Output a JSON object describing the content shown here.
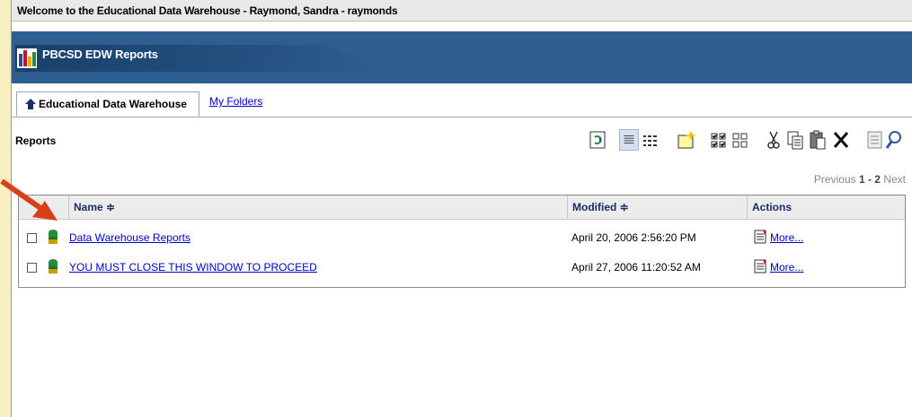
{
  "welcome": "Welcome to the Educational Data Warehouse - Raymond, Sandra - raymonds",
  "banner": {
    "title": "PBCSD EDW Reports"
  },
  "tabs": {
    "active": "Educational Data Warehouse",
    "my_folders": "My Folders"
  },
  "section_title": "Reports",
  "pager": {
    "previous": "Previous",
    "range": "1 - 2",
    "next": "Next"
  },
  "table": {
    "headers": {
      "name": "Name ≑",
      "modified": "Modified ≑",
      "actions": "Actions"
    },
    "rows": [
      {
        "name": "Data Warehouse Reports",
        "modified": "April 20, 2006 2:56:20 PM",
        "action": "More..."
      },
      {
        "name": "YOU MUST CLOSE THIS WINDOW TO PROCEED",
        "modified": "April 27, 2006 11:20:52 AM",
        "action": "More..."
      }
    ]
  },
  "colors": {
    "banner": "#2f5f91",
    "link": "#0000cc",
    "arrow": "#d9401a"
  }
}
